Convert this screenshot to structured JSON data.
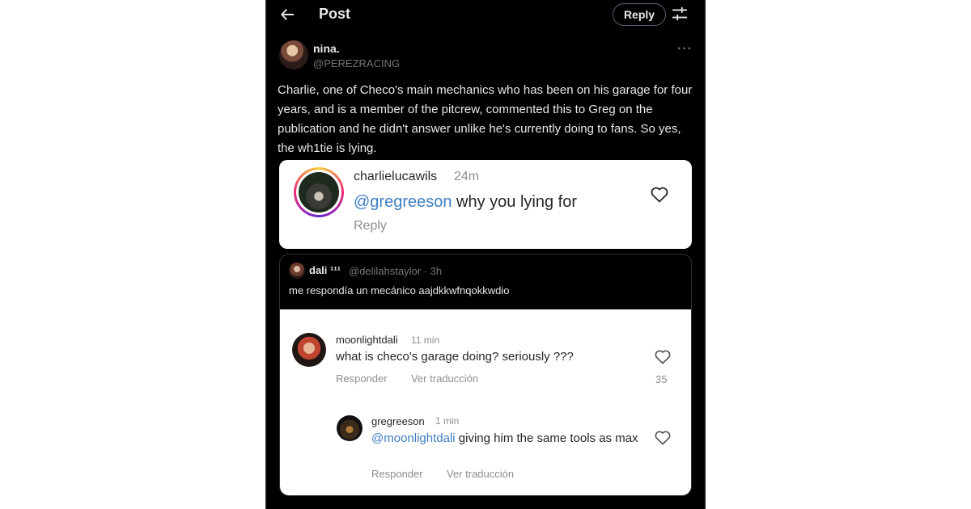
{
  "header": {
    "title": "Post",
    "reply_label": "Reply",
    "back_icon": "arrow-left-icon",
    "settings_icon": "sliders-icon"
  },
  "post": {
    "author_name": "nina.",
    "author_handle": "@PEREZRACING",
    "more_label": "···",
    "text": "Charlie, one of Checo's main mechanics who has been on his garage for four years, and is a member of the pitcrew, commented this to Greg on the publication and he didn't answer unlike he's currently doing to fans. So yes, the wh1tie is lying."
  },
  "quote1": {
    "username": "charlielucawils",
    "time": "24m",
    "mention": "@gregreeson",
    "text": " why you lying for",
    "reply_label": "Reply"
  },
  "quote2": {
    "name": "dali ¹¹¹",
    "meta": "@delilahstaylor · 3h",
    "text": "me respondía un mecánico aajdkkwfnqokkwdio",
    "comment": {
      "username": "moonlightdali",
      "time": "11 min",
      "text": "what is checo's garage doing? seriously ???",
      "reply_label": "Responder",
      "translate_label": "Ver traducción",
      "likes": "35"
    },
    "reply": {
      "username": "gregreeson",
      "time": "1 min",
      "mention": "@moonlightdali",
      "text": " giving him the same tools as max",
      "reply_label": "Responder",
      "translate_label": "Ver traducción"
    }
  },
  "colors": {
    "background": "#000000",
    "text_primary": "#e7e9ea",
    "text_secondary": "#71767b",
    "mention": "#3d7fc4"
  }
}
